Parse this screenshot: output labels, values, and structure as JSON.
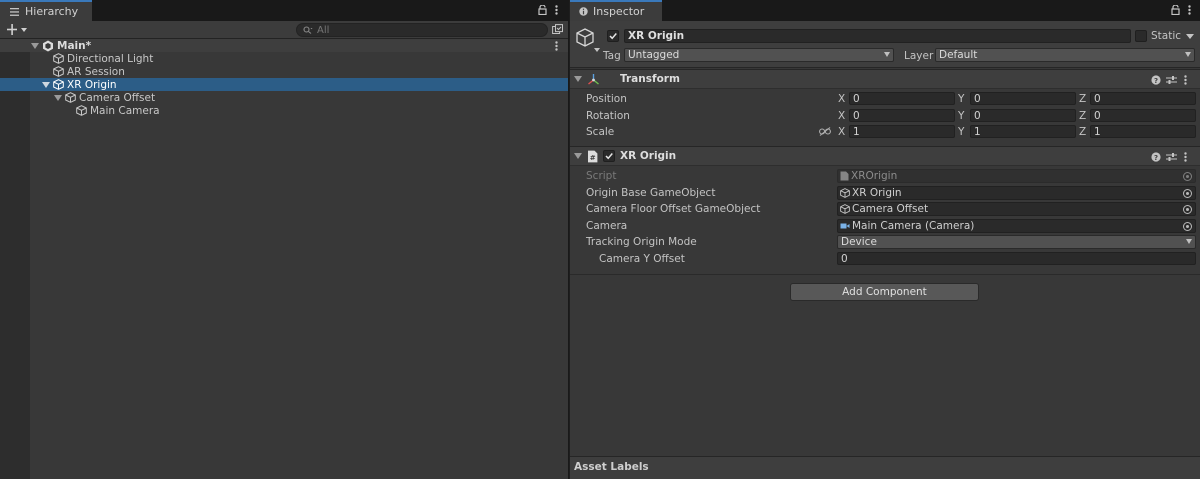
{
  "hierarchy": {
    "tab_label": "Hierarchy",
    "search_placeholder": "All",
    "scene_name": "Main*",
    "items": [
      {
        "label": "Directional Light"
      },
      {
        "label": "AR Session"
      },
      {
        "label": "XR Origin"
      },
      {
        "label": "Camera Offset"
      },
      {
        "label": "Main Camera"
      }
    ]
  },
  "inspector": {
    "tab_label": "Inspector",
    "object_name": "XR Origin",
    "static_label": "Static",
    "tag_label": "Tag",
    "tag_value": "Untagged",
    "layer_label": "Layer",
    "layer_value": "Default",
    "transform": {
      "title": "Transform",
      "position_label": "Position",
      "rotation_label": "Rotation",
      "scale_label": "Scale",
      "axis_x": "X",
      "axis_y": "Y",
      "axis_z": "Z",
      "position": {
        "x": "0",
        "y": "0",
        "z": "0"
      },
      "rotation": {
        "x": "0",
        "y": "0",
        "z": "0"
      },
      "scale": {
        "x": "1",
        "y": "1",
        "z": "1"
      }
    },
    "xr_origin": {
      "title": "XR Origin",
      "script_label": "Script",
      "script_value": "XROrigin",
      "origin_base_label": "Origin Base GameObject",
      "origin_base_value": "XR Origin",
      "camera_floor_label": "Camera Floor Offset GameObject",
      "camera_floor_value": "Camera Offset",
      "camera_label": "Camera",
      "camera_value": "Main Camera (Camera)",
      "tracking_mode_label": "Tracking Origin Mode",
      "tracking_mode_value": "Device",
      "camera_y_offset_label": "Camera Y Offset",
      "camera_y_offset_value": "0"
    },
    "add_component_label": "Add Component",
    "asset_labels_label": "Asset Labels"
  },
  "colors": {
    "selection": "#2c5d87",
    "tab_accent": "#3a79bb",
    "panel_bg": "#383838"
  }
}
